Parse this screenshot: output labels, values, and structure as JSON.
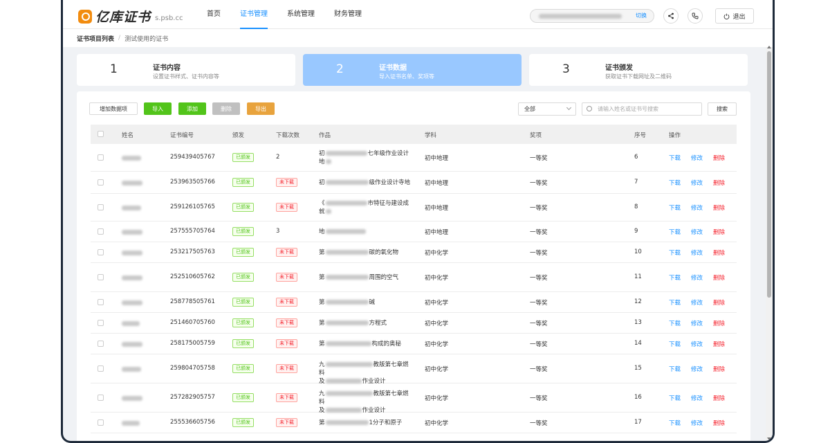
{
  "header": {
    "brand": "亿库证书",
    "domain": "s.psb.cc",
    "nav": [
      "首页",
      "证书管理",
      "系统管理",
      "财务管理"
    ],
    "switch_label": "切换",
    "logout_label": "退出"
  },
  "breadcrumb": {
    "root": "证书项目列表",
    "sep": "/",
    "current": "测试使用的证书"
  },
  "steps": [
    {
      "num": "1",
      "title": "证书内容",
      "desc": "设置证书样式、证书内容等"
    },
    {
      "num": "2",
      "title": "证书数据",
      "desc": "导入证书名单、奖项等"
    },
    {
      "num": "3",
      "title": "证书颁发",
      "desc": "获取证书下载网址及二维码"
    }
  ],
  "toolbar": {
    "add_field": "增加数据项",
    "import": "导入",
    "add": "添加",
    "delete": "删除",
    "export": "导出",
    "filter_value": "全部",
    "search_placeholder": "请输入姓名或证书号搜索",
    "search_btn": "搜索"
  },
  "columns": {
    "name": "姓名",
    "cert_no": "证书编号",
    "issue": "颁发",
    "downloads": "下载次数",
    "work": "作品",
    "subject": "学科",
    "award": "奖项",
    "seq": "序号",
    "ops": "操作"
  },
  "ops": {
    "download": "下载",
    "edit": "修改",
    "delete": "删除"
  },
  "rows": [
    {
      "cert": "259439405767",
      "issue": "已颁发",
      "dl": "2",
      "dl_tag": "",
      "w1a": "初",
      "w1b": "七年级作业设计",
      "w2a": "地",
      "w2b": "",
      "subject": "初中地理",
      "award": "一等奖",
      "seq": "6"
    },
    {
      "cert": "253963505766",
      "issue": "已颁发",
      "dl": "",
      "dl_tag": "未下载",
      "w1a": "初",
      "w1b": "级作业设计寺地",
      "w2a": "",
      "w2b": "",
      "subject": "初中地理",
      "award": "一等奖",
      "seq": "7"
    },
    {
      "cert": "259126105765",
      "issue": "已颁发",
      "dl": "",
      "dl_tag": "未下载",
      "w1a": "《",
      "w1b": "市特征与建设成",
      "w2a": "就",
      "w2b": "",
      "subject": "初中地理",
      "award": "一等奖",
      "seq": "8"
    },
    {
      "cert": "257555705764",
      "issue": "已颁发",
      "dl": "3",
      "dl_tag": "",
      "w1a": "地",
      "w1b": "",
      "w2a": "",
      "w2b": "",
      "subject": "初中地理",
      "award": "一等奖",
      "seq": "9"
    },
    {
      "cert": "253217505763",
      "issue": "已颁发",
      "dl": "",
      "dl_tag": "未下载",
      "w1a": "第",
      "w1b": "碳的氧化物",
      "w2a": "",
      "w2b": "",
      "subject": "初中化学",
      "award": "一等奖",
      "seq": "10"
    },
    {
      "cert": "252510605762",
      "issue": "已颁发",
      "dl": "",
      "dl_tag": "未下载",
      "w1a": "第",
      "w1b": "周围的空气",
      "w2a": "",
      "w2b": "",
      "subject": "初中化学",
      "award": "一等奖",
      "seq": "11"
    },
    {
      "cert": "258778505761",
      "issue": "已颁发",
      "dl": "",
      "dl_tag": "未下载",
      "w1a": "第",
      "w1b": "碱",
      "w2a": "",
      "w2b": "",
      "subject": "初中化学",
      "award": "一等奖",
      "seq": "12"
    },
    {
      "cert": "251460705760",
      "issue": "已颁发",
      "dl": "",
      "dl_tag": "未下载",
      "w1a": "第",
      "w1b": "方程式",
      "w2a": "",
      "w2b": "",
      "subject": "初中化学",
      "award": "一等奖",
      "seq": "13"
    },
    {
      "cert": "258175005759",
      "issue": "已颁发",
      "dl": "",
      "dl_tag": "未下载",
      "w1a": "第",
      "w1b": "构成的奥秘",
      "w2a": "",
      "w2b": "",
      "subject": "初中化学",
      "award": "一等奖",
      "seq": "14"
    },
    {
      "cert": "259804705758",
      "issue": "已颁发",
      "dl": "",
      "dl_tag": "未下载",
      "w1a": "九",
      "w1b": "教版第七章燃料",
      "w2a": "及",
      "w2b": "作业设计",
      "subject": "初中化学",
      "award": "一等奖",
      "seq": "15"
    },
    {
      "cert": "257282905757",
      "issue": "已颁发",
      "dl": "",
      "dl_tag": "未下载",
      "w1a": "九",
      "w1b": "教版第七章燃料",
      "w2a": "及",
      "w2b": "作业设计",
      "subject": "初中化学",
      "award": "一等奖",
      "seq": "16"
    },
    {
      "cert": "255536605756",
      "issue": "已颁发",
      "dl": "",
      "dl_tag": "未下载",
      "w1a": "第",
      "w1b": "1分子和原子",
      "w2a": "",
      "w2b": "",
      "subject": "初中化学",
      "award": "一等奖",
      "seq": "17"
    }
  ]
}
